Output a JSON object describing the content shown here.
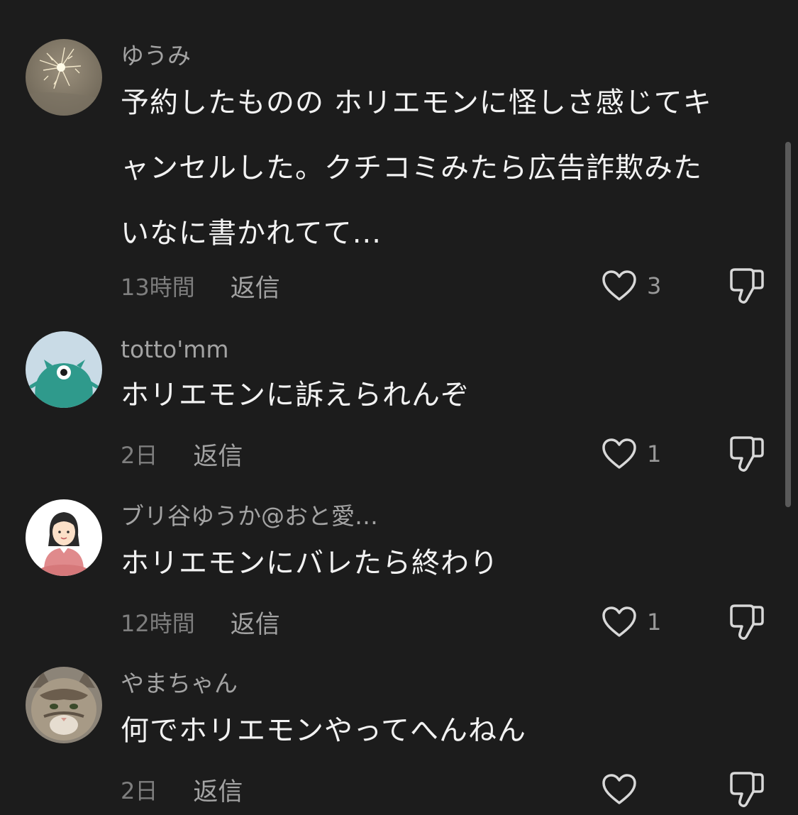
{
  "comments": [
    {
      "username": "ゆうみ",
      "text_lines": [
        "予約したものの ホリエモンに怪しさ感じてキ",
        "ャンセルした。クチコミみたら広告詐欺みた",
        "いなに書かれてて..."
      ],
      "timestamp": "13時間",
      "reply_label": "返信",
      "like_count": "3",
      "avatar": "sparkler-photo"
    },
    {
      "username": "totto'mm",
      "text_lines": [
        "ホリエモンに訴えられんぞ"
      ],
      "timestamp": "2日",
      "reply_label": "返信",
      "like_count": "1",
      "avatar": "green-monster-illustration"
    },
    {
      "username": "ブリ谷ゆうか@おと愛…",
      "text_lines": [
        "ホリエモンにバレたら終わり"
      ],
      "timestamp": "12時間",
      "reply_label": "返信",
      "like_count": "1",
      "avatar": "woman-illustration"
    },
    {
      "username": "やまちゃん",
      "text_lines": [
        "何でホリエモンやってへんねん"
      ],
      "timestamp": "2日",
      "reply_label": "返信",
      "like_count": "",
      "avatar": "cat-photo"
    }
  ],
  "icons": {
    "like": "heart-outline-icon",
    "dislike": "thumbs-down-outline-icon"
  },
  "colors": {
    "background": "#1c1c1c",
    "text": "#f2f2f2",
    "secondary_text": "#a3a3a3",
    "muted_text": "#7e7e7e"
  }
}
